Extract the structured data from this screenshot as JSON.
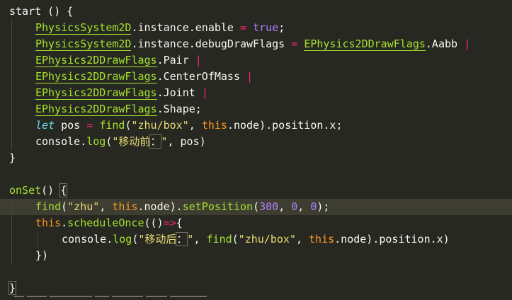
{
  "editor": {
    "lines": [
      {
        "indent": 0,
        "tokens": [
          [
            "plain",
            "start () {"
          ]
        ]
      },
      {
        "indent": 1,
        "tokens": [
          [
            "class",
            "PhysicsSystem2D"
          ],
          [
            "plain",
            ".instance.enable "
          ],
          [
            "kw",
            "="
          ],
          [
            "plain",
            " "
          ],
          [
            "const",
            "true"
          ],
          [
            "plain",
            ";"
          ]
        ]
      },
      {
        "indent": 1,
        "tokens": [
          [
            "class",
            "PhysicsSystem2D"
          ],
          [
            "plain",
            ".instance.debugDrawFlags "
          ],
          [
            "kw",
            "="
          ],
          [
            "plain",
            " "
          ],
          [
            "class",
            "EPhysics2DDrawFlags"
          ],
          [
            "plain",
            ".Aabb "
          ],
          [
            "kw",
            "|"
          ]
        ]
      },
      {
        "indent": 1,
        "tokens": [
          [
            "class",
            "EPhysics2DDrawFlags"
          ],
          [
            "plain",
            ".Pair "
          ],
          [
            "kw",
            "|"
          ]
        ]
      },
      {
        "indent": 1,
        "tokens": [
          [
            "class",
            "EPhysics2DDrawFlags"
          ],
          [
            "plain",
            ".CenterOfMass "
          ],
          [
            "kw",
            "|"
          ]
        ]
      },
      {
        "indent": 1,
        "tokens": [
          [
            "class",
            "EPhysics2DDrawFlags"
          ],
          [
            "plain",
            ".Joint "
          ],
          [
            "kw",
            "|"
          ]
        ]
      },
      {
        "indent": 1,
        "tokens": [
          [
            "class",
            "EPhysics2DDrawFlags"
          ],
          [
            "plain",
            ".Shape;"
          ]
        ]
      },
      {
        "indent": 1,
        "tokens": [
          [
            "storage",
            "let"
          ],
          [
            "plain",
            " pos "
          ],
          [
            "kw",
            "="
          ],
          [
            "plain",
            " "
          ],
          [
            "func",
            "find"
          ],
          [
            "plain",
            "("
          ],
          [
            "str",
            "\"zhu/box\""
          ],
          [
            "plain",
            ", "
          ],
          [
            "this",
            "this"
          ],
          [
            "plain",
            ".node).position.x;"
          ]
        ]
      },
      {
        "indent": 1,
        "tokens": [
          [
            "plain",
            "console."
          ],
          [
            "func",
            "log"
          ],
          [
            "plain",
            "("
          ],
          [
            "str",
            "\"移动前"
          ],
          [
            "cursor",
            "："
          ],
          [
            "str",
            "\""
          ],
          [
            "plain",
            ", pos)"
          ]
        ]
      },
      {
        "indent": 0,
        "tokens": [
          [
            "plain",
            "}"
          ]
        ]
      },
      {
        "indent": 0,
        "tokens": []
      },
      {
        "indent": 0,
        "tokens": [
          [
            "func",
            "onSet"
          ],
          [
            "plain",
            "() "
          ],
          [
            "cursor",
            "{"
          ]
        ]
      },
      {
        "indent": 1,
        "active": true,
        "tokens": [
          [
            "func",
            "find"
          ],
          [
            "plain",
            "("
          ],
          [
            "str",
            "\"zhu\""
          ],
          [
            "plain",
            ", "
          ],
          [
            "this",
            "this"
          ],
          [
            "plain",
            ".node)."
          ],
          [
            "func",
            "setPosition"
          ],
          [
            "plain",
            "("
          ],
          [
            "num",
            "300"
          ],
          [
            "plain",
            ", "
          ],
          [
            "num",
            "0"
          ],
          [
            "plain",
            ", "
          ],
          [
            "num",
            "0"
          ],
          [
            "plain",
            ");"
          ]
        ]
      },
      {
        "indent": 1,
        "tokens": [
          [
            "this",
            "this"
          ],
          [
            "plain",
            "."
          ],
          [
            "func",
            "scheduleOnce"
          ],
          [
            "plain",
            "(()"
          ],
          [
            "kw",
            "=>"
          ],
          [
            "plain",
            "{"
          ]
        ]
      },
      {
        "indent": 2,
        "tokens": [
          [
            "plain",
            "console."
          ],
          [
            "func",
            "log"
          ],
          [
            "plain",
            "("
          ],
          [
            "str",
            "\"移动后"
          ],
          [
            "cursor",
            "："
          ],
          [
            "str",
            "\""
          ],
          [
            "plain",
            ", "
          ],
          [
            "func",
            "find"
          ],
          [
            "plain",
            "("
          ],
          [
            "str",
            "\"zhu/box\""
          ],
          [
            "plain",
            ", "
          ],
          [
            "this",
            "this"
          ],
          [
            "plain",
            ".node).position.x)"
          ]
        ]
      },
      {
        "indent": 1,
        "tokens": [
          [
            "plain",
            "})"
          ]
        ]
      },
      {
        "indent": 0,
        "tokens": []
      },
      {
        "indent": 0,
        "tokens": [
          [
            "cursor",
            "}"
          ]
        ]
      }
    ]
  },
  "colors": {
    "background": "#272822",
    "foreground": "#F8F8F2",
    "keyword": "#F92672",
    "constant": "#AE81FF",
    "string": "#E6DB74",
    "function": "#A6E22E",
    "this": "#FD971F",
    "storage": "#66D9EF",
    "active_line": "#3E3D32"
  }
}
